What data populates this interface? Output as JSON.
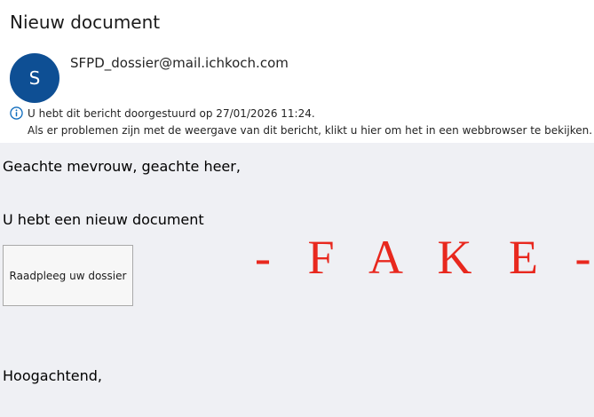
{
  "message": {
    "subject": "Nieuw document",
    "sender": {
      "avatar_initial": "S",
      "address": "SFPD_dossier@mail.ichkoch.com"
    },
    "info_bar": {
      "icon": "info-icon",
      "forwarded_notice": "U hebt dit bericht doorgestuurd op 27/01/2026 11:24.",
      "view_in_browser_notice": "Als er problemen zijn met de weergave van dit bericht, klikt u hier om het in een webbrowser te bekijken."
    }
  },
  "body": {
    "greeting": "Geachte mevrouw, geachte heer,",
    "intro": "U hebt een nieuw document",
    "button_label": "Raadpleeg uw dossier",
    "stamp": "- F A K E -",
    "closing": "Hoogachtend,"
  },
  "colors": {
    "avatar": "#0e4f94",
    "body_background": "#eff0f4",
    "stamp": "#e8281e",
    "info_icon": "#0f6cbd"
  }
}
